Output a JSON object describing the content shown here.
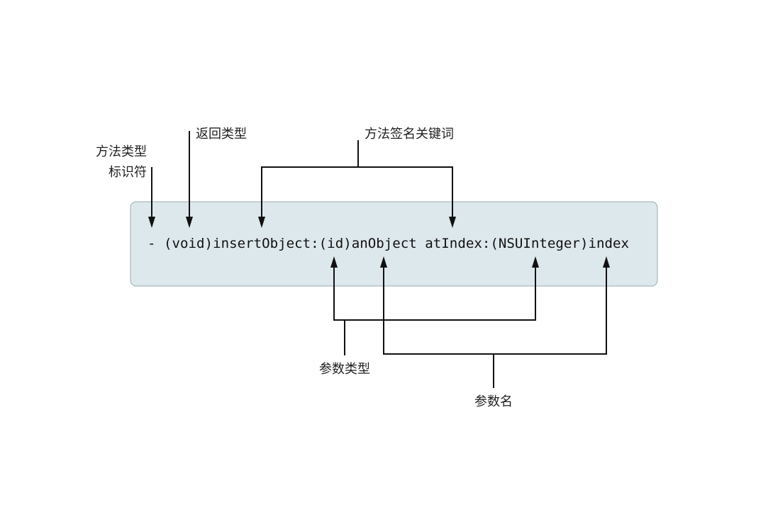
{
  "code": {
    "signature": "- (void)insertObject:(id)anObject atIndex:(NSUInteger)index"
  },
  "labels": {
    "method_type_line1": "方法类型",
    "method_type_line2": "标识符",
    "return_type": "返回类型",
    "signature_keywords": "方法签名关键词",
    "param_type": "参数类型",
    "param_name": "参数名"
  },
  "colors": {
    "box_fill": "#dde8ec",
    "box_stroke": "#a9b9bf",
    "line": "#111111"
  }
}
